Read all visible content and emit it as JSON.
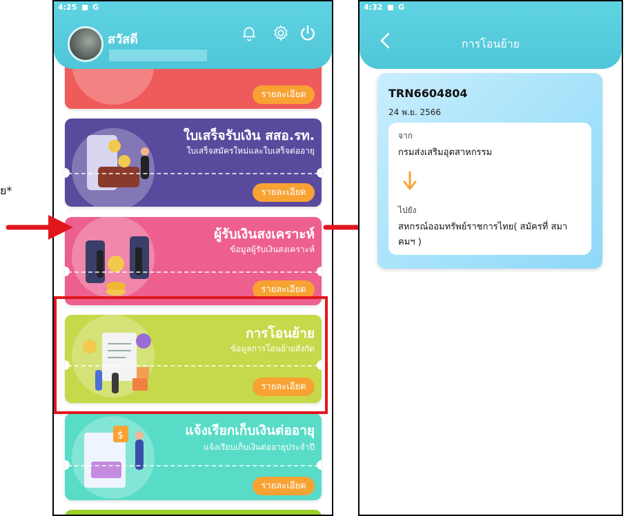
{
  "left_edge_text": "ย*",
  "left_phone": {
    "status_time": "4:25",
    "greeting": "สวัสดี",
    "cards": [
      {
        "button": "รายละเอียด"
      },
      {
        "title": "ใบเสร็จรับเงิน สสอ.รท.",
        "subtitle": "ใบเสร็จสมัครใหม่และใบเสร็จต่ออายุ",
        "button": "รายละเอียด"
      },
      {
        "title": "ผู้รับเงินสงเคราะห์",
        "subtitle": "ข้อมูลผู้รับเงินสงเคราะห์",
        "button": "รายละเอียด"
      },
      {
        "title": "การโอนย้าย",
        "subtitle": "ข้อมูลการโอนย้ายสังกัด",
        "button": "รายละเอียด"
      },
      {
        "title": "แจ้งเรียกเก็บเงินต่ออายุ",
        "subtitle": "แจ้งเรียบเก็บเงินต่ออายุประจำปี",
        "button": "รายละเอียด"
      }
    ]
  },
  "right_phone": {
    "status_time": "4:32",
    "title": "การโอนย้าย",
    "transfer": {
      "id": "TRN6604804",
      "date": "24 พ.ย. 2566",
      "from_label": "จาก",
      "from_value": "กรมส่งเสริมอุตสาหกรรม",
      "to_label": "ไปยัง",
      "to_value_line1": "สหกรณ์ออมทรัพย์ราชการไทย( สมัครที่ สมา",
      "to_value_line2": "คมฯ )"
    }
  },
  "colors": {
    "header": "#4fc6d8",
    "card_red": "#ef5a5a",
    "card_purple": "#5a4a9e",
    "card_pink": "#ec5f8f",
    "card_lime": "#c6d94a",
    "card_teal": "#58dcc8",
    "card_green": "#9ccf2a",
    "button_orange": "#f7a233",
    "arrow_red": "#e0161c",
    "arrow_orange": "#f7a233"
  }
}
